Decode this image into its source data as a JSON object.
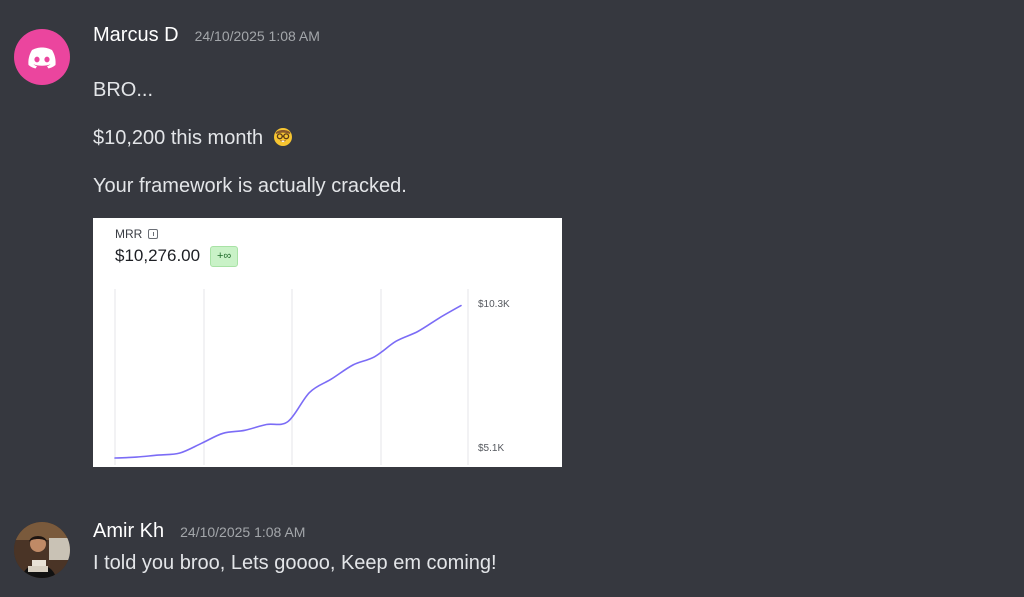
{
  "messages": [
    {
      "author": "Marcus D",
      "timestamp": "24/10/2025 1:08 AM",
      "avatar_icon": "discord-logo-icon",
      "lines": [
        "BRO...",
        "$10,200 this month",
        "Your framework is actually cracked."
      ],
      "line2_emoji": "nerd-face-emoji-icon",
      "embed": {
        "label": "MRR",
        "value": "$10,276.00",
        "badge": "+∞"
      }
    },
    {
      "author": "Amir Kh",
      "timestamp": "24/10/2025 1:08 AM",
      "avatar_icon": "profile-photo",
      "lines": [
        "I told you broo, Lets goooo, Keep em coming!"
      ]
    }
  ],
  "chart_data": {
    "type": "line",
    "title": "MRR",
    "series": [
      {
        "values": [
          5.1,
          5.13,
          5.2,
          5.27,
          5.6,
          5.94,
          6.04,
          6.24,
          6.34,
          7.33,
          7.78,
          8.26,
          8.54,
          9.07,
          9.4,
          9.86,
          10.28
        ]
      }
    ],
    "x": [
      0,
      1,
      2,
      3,
      4,
      5,
      6,
      7,
      8,
      9,
      10,
      11,
      12,
      13,
      14,
      15,
      16
    ],
    "ylim": [
      5.1,
      10.3
    ],
    "y_ticks": [
      "$10.3K",
      "$5.1K"
    ],
    "grid": "vertical",
    "line_color": "#7b6cf6"
  }
}
